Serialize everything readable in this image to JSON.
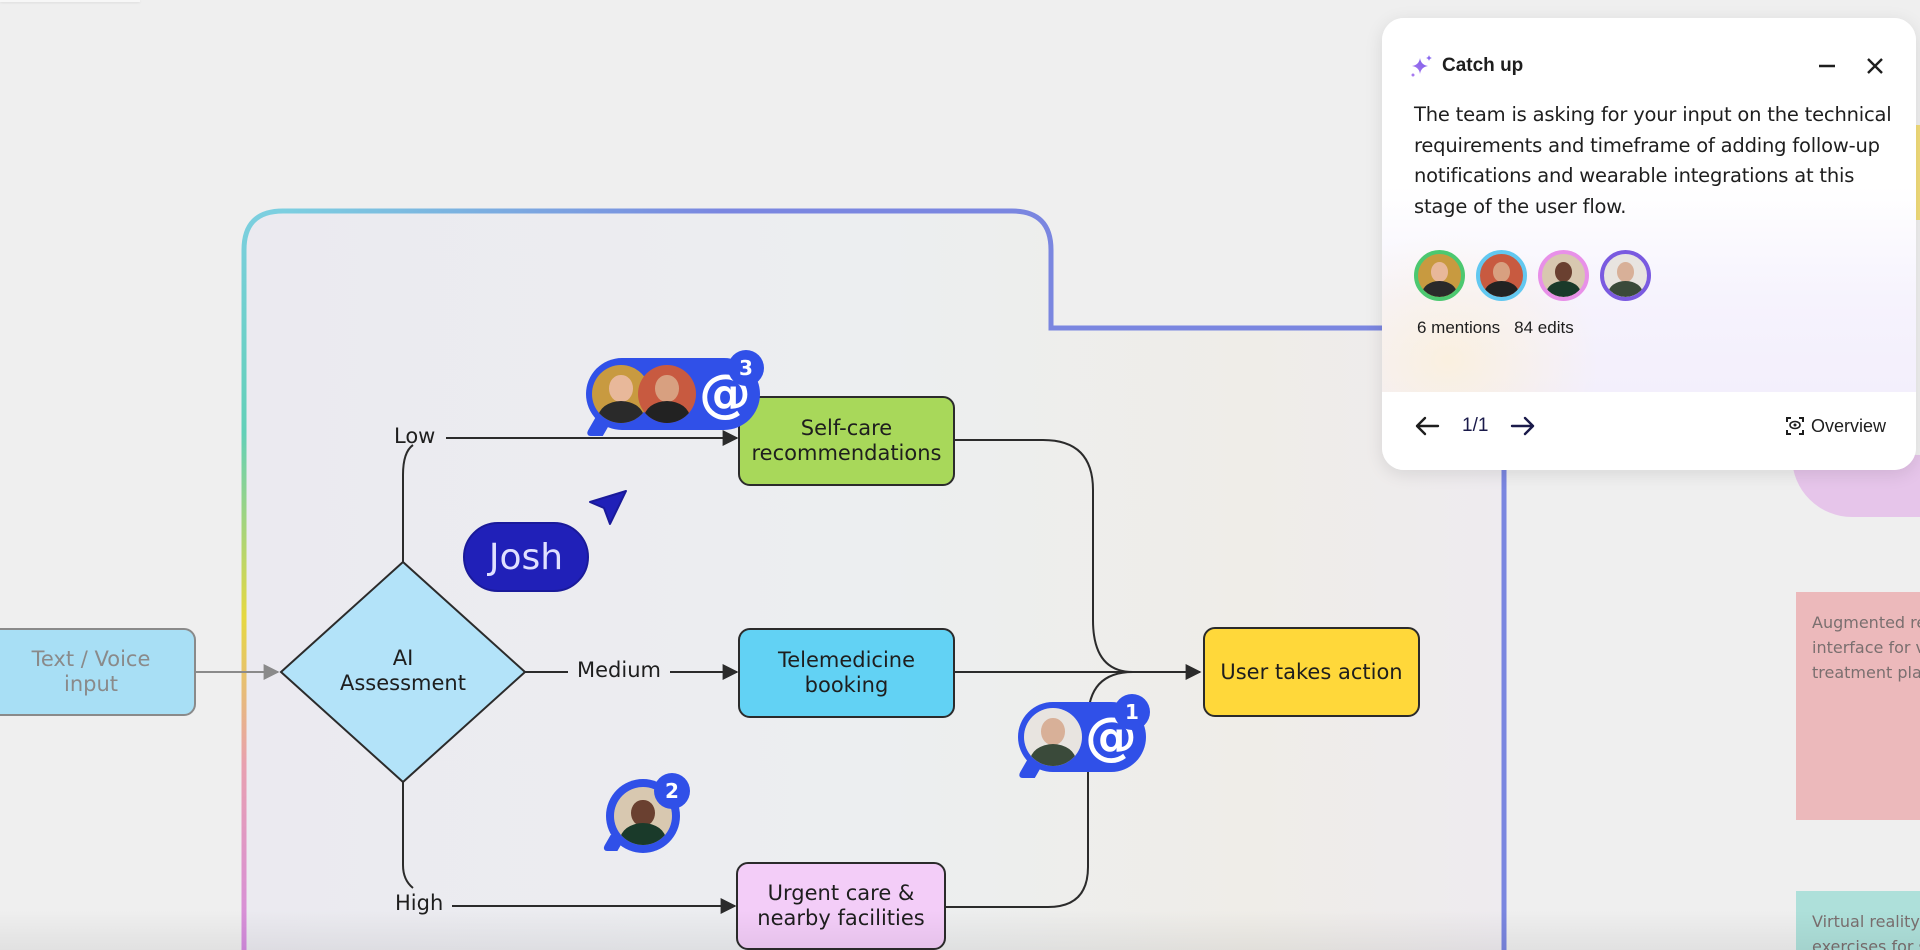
{
  "canvas": {
    "frame_colors": {
      "left_top": "#7ccfe0",
      "left_mid": "#e6d840",
      "left_bottom": "#d48ce0",
      "right": "#7a86e0"
    }
  },
  "diagram": {
    "nodes": {
      "input": "Text / Voice\ninput",
      "assessment": "AI\nAssessment",
      "selfcare": "Self-care\nrecommendations",
      "telemedicine": "Telemedicine\nbooking",
      "urgent": "Urgent care &\nnearby facilities",
      "action": "User takes action"
    },
    "branches": {
      "low": "Low",
      "medium": "Medium",
      "high": "High"
    }
  },
  "collaborators": {
    "cursor_name": "Josh",
    "cursor_color": "#2020b8",
    "mention_groups": [
      {
        "count": "3",
        "avatars": 2
      },
      {
        "count": "1",
        "avatars": 1
      }
    ],
    "comment_badge": {
      "count": "2"
    }
  },
  "stickies": [
    {
      "text": "Augmented re\ninterface for vi\ntreatment plar",
      "color": "#ecb9bb"
    },
    {
      "text": "Virtual reality r\nexercises for s",
      "color": "#aee0da"
    }
  ],
  "catch_up": {
    "title": "Catch up",
    "summary": "The team is asking for your input on the technical requirements and timeframe of adding follow-up notifications and wearable integrations at this stage of the user flow.",
    "avatar_rings": [
      "#4cc870",
      "#62c8f0",
      "#e890e8",
      "#7a5ae0"
    ],
    "mentions": "6 mentions",
    "edits": "84 edits",
    "pager": "1/1",
    "overview_label": "Overview"
  }
}
